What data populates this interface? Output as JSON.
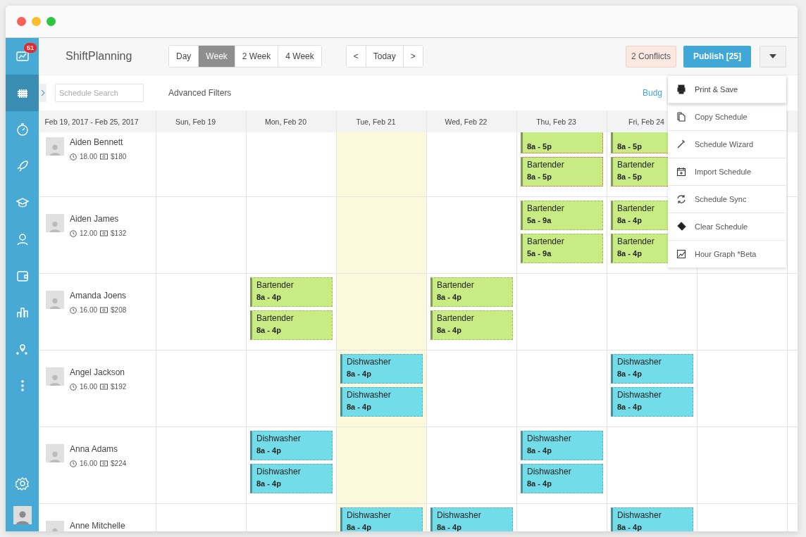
{
  "sidebar": {
    "badge": "51",
    "items": [
      {
        "selected": false
      },
      {
        "selected": true
      },
      {
        "selected": false
      },
      {
        "selected": false
      },
      {
        "selected": false
      },
      {
        "selected": false
      },
      {
        "selected": false
      },
      {
        "selected": false
      },
      {
        "selected": false
      },
      {
        "selected": false
      }
    ]
  },
  "header": {
    "brand": "ShiftPlanning",
    "views": [
      {
        "label": "Day",
        "selected": false
      },
      {
        "label": "Week",
        "selected": true
      },
      {
        "label": "2 Week",
        "selected": false
      },
      {
        "label": "4 Week",
        "selected": false
      }
    ],
    "nav": [
      "<",
      "Today",
      ">"
    ],
    "conflicts": "2 Conflicts",
    "publish": "Publish [25]"
  },
  "filters": {
    "search_placeholder": "Schedule Search",
    "advanced": "Advanced Filters",
    "budget_link": "Budg"
  },
  "range": "Feb 19, 2017 - Feb 25, 2017",
  "columns": [
    {
      "label": "Sun, Feb 19",
      "today": false
    },
    {
      "label": "Mon, Feb 20",
      "today": false
    },
    {
      "label": "Tue, Feb 21",
      "today": true
    },
    {
      "label": "Wed, Feb 22",
      "today": false
    },
    {
      "label": "Thu, Feb 23",
      "today": false
    },
    {
      "label": "Fri, Feb 24",
      "today": false
    },
    {
      "today": false
    }
  ],
  "rows": [
    {
      "name": "Aiden Bennett",
      "hours": "18.00",
      "pay": "$180",
      "cells": [
        {
          "kind": "empty"
        },
        {
          "kind": "empty"
        },
        {
          "kind": "empty"
        },
        {
          "kind": "empty"
        },
        {
          "kind": "shifts",
          "shifts": [
            {
              "time": "8a - 5p",
              "color": "#c8ec83",
              "conflict": true
            },
            {
              "role": "Bartender",
              "time": "8a - 5p",
              "color": "#c8ec83",
              "conflict": true
            }
          ]
        },
        {
          "kind": "shifts",
          "shifts": [
            {
              "time": "8a - 5p",
              "color": "#c8ec83",
              "conflict": true
            },
            {
              "role": "Bartender",
              "time": "8a - 5p",
              "color": "#c8ec83",
              "conflict": true
            }
          ]
        },
        {
          "kind": "empty"
        }
      ]
    },
    {
      "name": "Aiden James",
      "hours": "12.00",
      "pay": "$132",
      "cells": [
        {
          "kind": "empty"
        },
        {
          "kind": "empty"
        },
        {
          "kind": "empty"
        },
        {
          "kind": "empty"
        },
        {
          "kind": "shifts",
          "shifts": [
            {
              "role": "Bartender",
              "time": "5a - 9a",
              "color": "#c8ec83",
              "conflict": false
            },
            {
              "role": "Bartender",
              "time": "5a - 9a",
              "color": "#c8ec83",
              "conflict": false
            }
          ]
        },
        {
          "kind": "shifts",
          "shifts": [
            {
              "role": "Bartender",
              "time": "8a - 4p",
              "color": "#c8ec83",
              "conflict": false
            },
            {
              "role": "Bartender",
              "time": "8a - 4p",
              "color": "#c8ec83",
              "conflict": false
            }
          ]
        },
        {
          "kind": "empty"
        }
      ]
    },
    {
      "name": "Amanda Joens",
      "hours": "16.00",
      "pay": "$208",
      "cells": [
        {
          "kind": "empty"
        },
        {
          "kind": "shifts",
          "shifts": [
            {
              "role": "Bartender",
              "time": "8a - 4p",
              "color": "#c8ec83",
              "conflict": false
            },
            {
              "role": "Bartender",
              "time": "8a - 4p",
              "color": "#c8ec83",
              "conflict": false
            }
          ]
        },
        {
          "kind": "empty"
        },
        {
          "kind": "shifts",
          "shifts": [
            {
              "role": "Bartender",
              "time": "8a - 4p",
              "color": "#c8ec83",
              "conflict": false
            },
            {
              "role": "Bartender",
              "time": "8a - 4p",
              "color": "#c8ec83",
              "conflict": false
            }
          ]
        },
        {
          "kind": "empty"
        },
        {
          "kind": "empty"
        },
        {
          "kind": "empty"
        }
      ]
    },
    {
      "name": "Angel Jackson",
      "hours": "16.00",
      "pay": "$192",
      "cells": [
        {
          "kind": "empty"
        },
        {
          "kind": "empty"
        },
        {
          "kind": "shifts",
          "shifts": [
            {
              "role": "Dishwasher",
              "time": "8a - 4p",
              "color": "#72dde9",
              "conflict": false
            },
            {
              "role": "Dishwasher",
              "time": "8a - 4p",
              "color": "#72dde9",
              "conflict": false
            }
          ]
        },
        {
          "kind": "empty"
        },
        {
          "kind": "empty"
        },
        {
          "kind": "shifts",
          "shifts": [
            {
              "role": "Dishwasher",
              "time": "8a - 4p",
              "color": "#72dde9",
              "conflict": false
            },
            {
              "role": "Dishwasher",
              "time": "8a - 4p",
              "color": "#72dde9",
              "conflict": false
            }
          ]
        },
        {
          "kind": "empty"
        }
      ]
    },
    {
      "name": "Anna Adams",
      "hours": "16.00",
      "pay": "$224",
      "cells": [
        {
          "kind": "empty"
        },
        {
          "kind": "shifts",
          "shifts": [
            {
              "role": "Dishwasher",
              "time": "8a - 4p",
              "color": "#72dde9",
              "conflict": false
            },
            {
              "role": "Dishwasher",
              "time": "8a - 4p",
              "color": "#72dde9",
              "conflict": false
            }
          ]
        },
        {
          "kind": "empty"
        },
        {
          "kind": "empty"
        },
        {
          "kind": "shifts",
          "shifts": [
            {
              "role": "Dishwasher",
              "time": "8a - 4p",
              "color": "#72dde9",
              "conflict": false
            },
            {
              "role": "Dishwasher",
              "time": "8a - 4p",
              "color": "#72dde9",
              "conflict": false
            }
          ]
        },
        {
          "kind": "empty"
        },
        {
          "kind": "empty"
        }
      ]
    },
    {
      "name": "Anne Mitchelle",
      "cells": [
        {
          "kind": "empty"
        },
        {
          "kind": "empty"
        },
        {
          "kind": "shifts",
          "shifts": [
            {
              "role": "Dishwasher",
              "time": "8a - 4p",
              "color": "#72dde9",
              "conflict": false
            }
          ]
        },
        {
          "kind": "shifts",
          "shifts": [
            {
              "role": "Dishwasher",
              "time": "8a - 4p",
              "color": "#72dde9",
              "conflict": false
            }
          ]
        },
        {
          "kind": "empty"
        },
        {
          "kind": "shifts",
          "shifts": [
            {
              "role": "Dishwasher",
              "time": "8a - 4p",
              "color": "#72dde9",
              "conflict": false
            }
          ]
        },
        {
          "kind": "empty"
        }
      ]
    }
  ],
  "menu": [
    {
      "label": "Print & Save",
      "selected": true
    },
    {
      "label": "Copy Schedule",
      "selected": false
    },
    {
      "label": "Schedule Wizard",
      "selected": false
    },
    {
      "label": "Import Schedule",
      "selected": false
    },
    {
      "label": "Schedule Sync",
      "selected": false
    },
    {
      "label": "Clear Schedule",
      "selected": false
    },
    {
      "label": "Hour Graph *Beta",
      "selected": false
    }
  ]
}
